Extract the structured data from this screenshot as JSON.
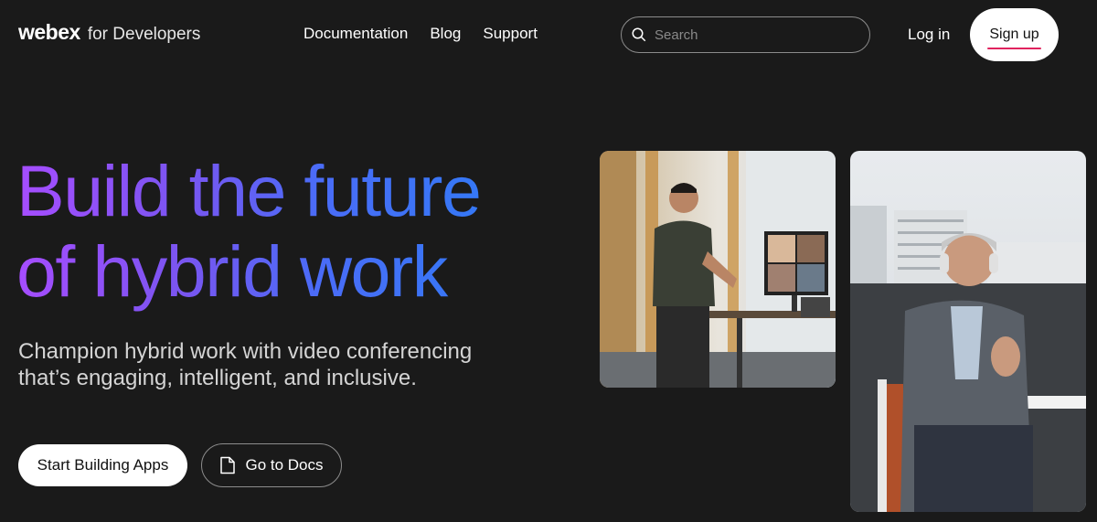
{
  "header": {
    "brand_logo": "webex",
    "brand_sub": "for Developers",
    "nav": [
      {
        "label": "Documentation"
      },
      {
        "label": "Blog"
      },
      {
        "label": "Support"
      }
    ],
    "search": {
      "placeholder": "Search",
      "value": ""
    },
    "login_label": "Log in",
    "signup_label": "Sign up"
  },
  "hero": {
    "title_line1": "Build the future",
    "title_line2": "of hybrid work",
    "subtitle_line1": "Champion hybrid work with video conferencing",
    "subtitle_line2": "that’s engaging, intelligent, and inclusive.",
    "primary_cta": "Start Building Apps",
    "secondary_cta": "Go to Docs"
  },
  "images": [
    {
      "icon": "office-video-call-photo"
    },
    {
      "icon": "man-with-headphones-photo"
    }
  ],
  "colors": {
    "background": "#1a1a1a",
    "title_gradient_start": "#a64dff",
    "title_gradient_end": "#2a7ef5",
    "signup_underline": "#e0235e"
  }
}
